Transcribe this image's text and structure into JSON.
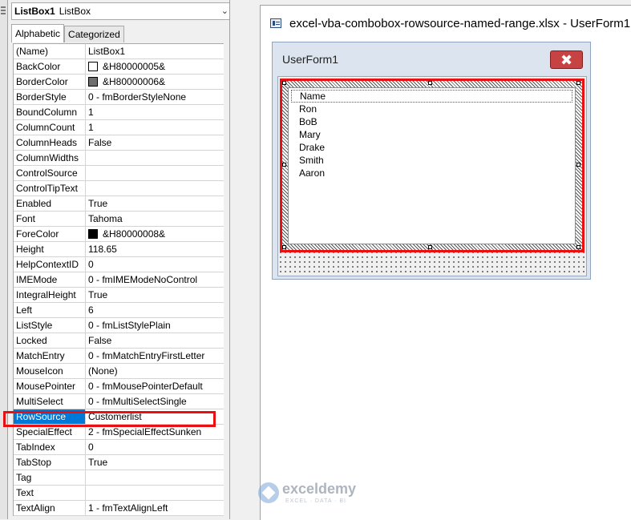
{
  "object_selector": {
    "name": "ListBox1",
    "type": "ListBox"
  },
  "tabs": [
    {
      "label": "Alphabetic",
      "active": true
    },
    {
      "label": "Categorized",
      "active": false
    }
  ],
  "properties": [
    {
      "name": "(Name)",
      "value": "ListBox1"
    },
    {
      "name": "BackColor",
      "value": "&H80000005&",
      "swatch": "#ffffff"
    },
    {
      "name": "BorderColor",
      "value": "&H80000006&",
      "swatch": "#6d6d6d"
    },
    {
      "name": "BorderStyle",
      "value": "0 - fmBorderStyleNone"
    },
    {
      "name": "BoundColumn",
      "value": "1"
    },
    {
      "name": "ColumnCount",
      "value": "1"
    },
    {
      "name": "ColumnHeads",
      "value": "False"
    },
    {
      "name": "ColumnWidths",
      "value": ""
    },
    {
      "name": "ControlSource",
      "value": ""
    },
    {
      "name": "ControlTipText",
      "value": ""
    },
    {
      "name": "Enabled",
      "value": "True"
    },
    {
      "name": "Font",
      "value": "Tahoma"
    },
    {
      "name": "ForeColor",
      "value": "&H80000008&",
      "swatch": "#000000"
    },
    {
      "name": "Height",
      "value": "118.65"
    },
    {
      "name": "HelpContextID",
      "value": "0"
    },
    {
      "name": "IMEMode",
      "value": "0 - fmIMEModeNoControl"
    },
    {
      "name": "IntegralHeight",
      "value": "True"
    },
    {
      "name": "Left",
      "value": "6"
    },
    {
      "name": "ListStyle",
      "value": "0 - fmListStylePlain"
    },
    {
      "name": "Locked",
      "value": "False"
    },
    {
      "name": "MatchEntry",
      "value": "0 - fmMatchEntryFirstLetter"
    },
    {
      "name": "MouseIcon",
      "value": "(None)"
    },
    {
      "name": "MousePointer",
      "value": "0 - fmMousePointerDefault"
    },
    {
      "name": "MultiSelect",
      "value": "0 - fmMultiSelectSingle"
    },
    {
      "name": "RowSource",
      "value": "Customerlist",
      "selected": true
    },
    {
      "name": "SpecialEffect",
      "value": "2 - fmSpecialEffectSunken"
    },
    {
      "name": "TabIndex",
      "value": "0"
    },
    {
      "name": "TabStop",
      "value": "True"
    },
    {
      "name": "Tag",
      "value": ""
    },
    {
      "name": "Text",
      "value": ""
    },
    {
      "name": "TextAlign",
      "value": "1 - fmTextAlignLeft"
    }
  ],
  "designer": {
    "window_title": "excel-vba-combobox-rowsource-named-range.xlsx - UserForm1",
    "userform_caption": "UserForm1",
    "close_glyph": "✖",
    "listbox_items": [
      "Name",
      "Ron",
      "BoB",
      "Mary",
      "Drake",
      "Smith",
      "Aaron"
    ]
  },
  "watermark": {
    "name": "exceldemy",
    "tagline": "EXCEL · DATA · BI"
  },
  "colors": {
    "highlight_red": "#e81010",
    "selection_blue": "#0078d7"
  }
}
